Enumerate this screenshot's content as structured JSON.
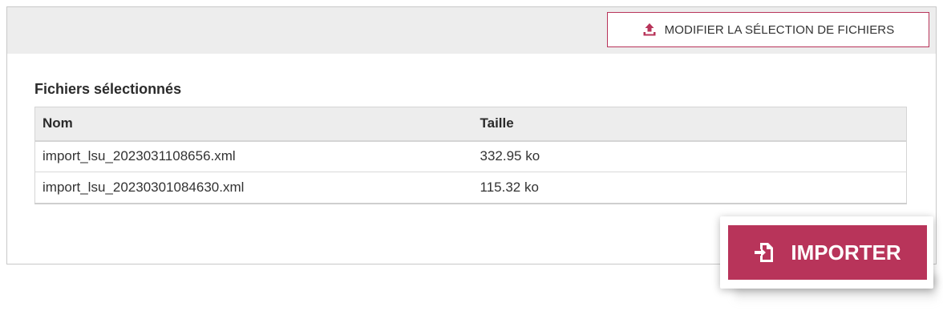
{
  "header": {
    "modify_selection_label": "MODIFIER LA SÉLECTION DE FICHIERS",
    "modify_icon": "upload-icon"
  },
  "section": {
    "title": "Fichiers sélectionnés"
  },
  "table": {
    "headers": {
      "name": "Nom",
      "size": "Taille"
    },
    "rows": [
      {
        "name": "import_lsu_2023031108656.xml",
        "size": "332.95 ko"
      },
      {
        "name": "import_lsu_20230301084630.xml",
        "size": "115.32 ko"
      }
    ]
  },
  "actions": {
    "import_label": "IMPORTER",
    "import_icon": "file-import-icon"
  },
  "colors": {
    "accent": "#b8345a",
    "header_bg": "#ededed",
    "border": "#c9c9c9"
  }
}
